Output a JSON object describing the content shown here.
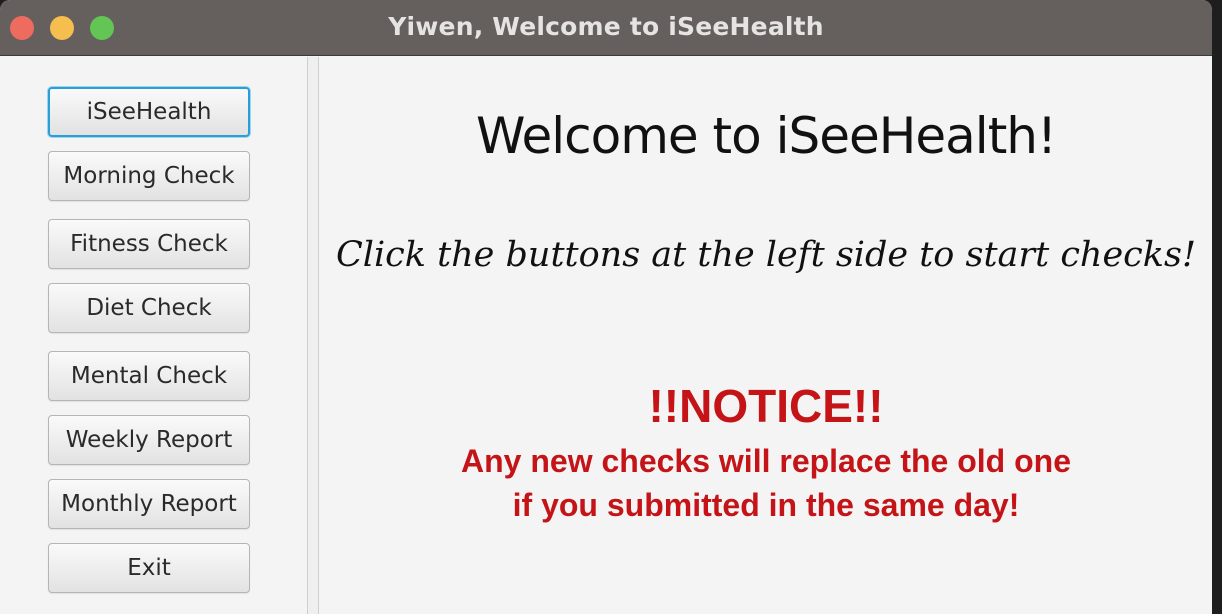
{
  "window": {
    "title": "Yiwen, Welcome to iSeeHealth"
  },
  "sidebar": {
    "buttons": [
      {
        "label": "iSeeHealth"
      },
      {
        "label": "Morning Check"
      },
      {
        "label": "Fitness Check"
      },
      {
        "label": "Diet Check"
      },
      {
        "label": "Mental Check"
      },
      {
        "label": "Weekly Report"
      },
      {
        "label": "Monthly Report"
      },
      {
        "label": "Exit"
      }
    ],
    "focused_button": "iSeeHealth"
  },
  "main": {
    "heading": "Welcome to iSeeHealth!",
    "instruction": "Click the buttons at the left side to start checks!",
    "notice_title": "!!NOTICE!!",
    "notice_lines": [
      "Any new checks will replace the old one",
      "if you submitted in the same day!"
    ]
  },
  "colors": {
    "titlebar": "#655f5d",
    "notice": "#c41417",
    "focus_ring": "#2a9fd6",
    "close_light": "#ee6b5f",
    "minimize_light": "#f5be4f",
    "maximize_light": "#62c554"
  }
}
